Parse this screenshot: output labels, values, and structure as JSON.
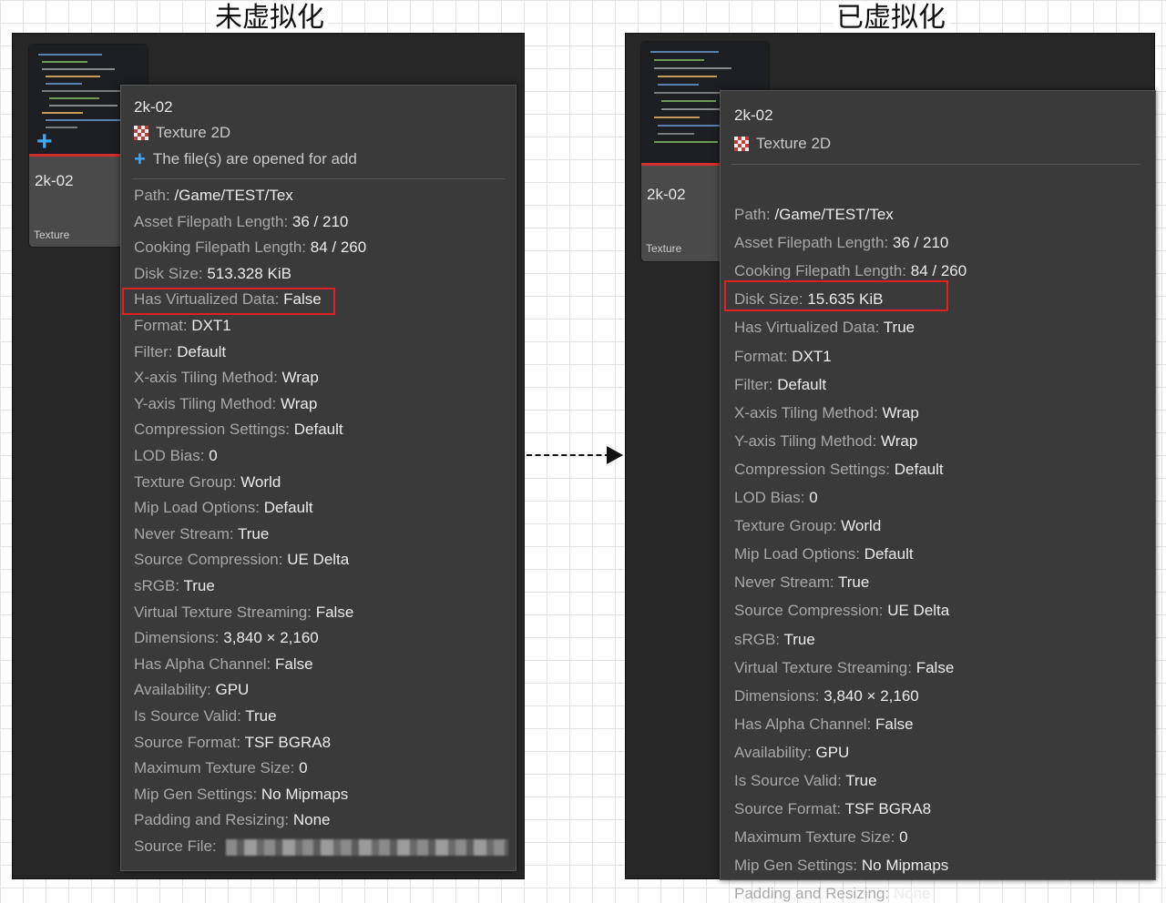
{
  "left": {
    "heading": "未虚拟化",
    "asset_name": "2k-02",
    "asset_type_label": "Texture",
    "tooltip": {
      "name": "2k-02",
      "type": "Texture 2D",
      "status": "The file(s) are opened for add",
      "rows": [
        {
          "k": "Path:",
          "v": "/Game/TEST/Tex"
        },
        {
          "k": "Asset Filepath Length:",
          "v": "36 / 210"
        },
        {
          "k": "Cooking Filepath Length:",
          "v": "84 / 260"
        },
        {
          "k": "Disk Size:",
          "v": "513.328 KiB"
        },
        {
          "k": "Has Virtualized Data:",
          "v": "False"
        },
        {
          "k": "Format:",
          "v": "DXT1"
        },
        {
          "k": "Filter:",
          "v": "Default"
        },
        {
          "k": "X-axis Tiling Method:",
          "v": "Wrap"
        },
        {
          "k": "Y-axis Tiling Method:",
          "v": "Wrap"
        },
        {
          "k": "Compression Settings:",
          "v": "Default"
        },
        {
          "k": "LOD Bias:",
          "v": "0"
        },
        {
          "k": "Texture Group:",
          "v": "World"
        },
        {
          "k": "Mip Load Options:",
          "v": "Default"
        },
        {
          "k": "Never Stream:",
          "v": "True"
        },
        {
          "k": "Source Compression:",
          "v": "UE Delta"
        },
        {
          "k": "sRGB:",
          "v": "True"
        },
        {
          "k": "Virtual Texture Streaming:",
          "v": "False"
        },
        {
          "k": "Dimensions:",
          "v": "3,840 × 2,160"
        },
        {
          "k": "Has Alpha Channel:",
          "v": "False"
        },
        {
          "k": "Availability:",
          "v": "GPU"
        },
        {
          "k": "Is Source Valid:",
          "v": "True"
        },
        {
          "k": "Source Format:",
          "v": "TSF BGRA8"
        },
        {
          "k": "Maximum Texture Size:",
          "v": "0"
        },
        {
          "k": "Mip Gen Settings:",
          "v": "No Mipmaps"
        },
        {
          "k": "Padding and Resizing:",
          "v": "None"
        },
        {
          "k": "Source File:",
          "v": ""
        }
      ]
    }
  },
  "right": {
    "heading": "已虚拟化",
    "asset_name": "2k-02",
    "asset_type_label": "Texture",
    "tooltip": {
      "name": "2k-02",
      "type": "Texture 2D",
      "rows": [
        {
          "k": "Path:",
          "v": "/Game/TEST/Tex"
        },
        {
          "k": "Asset Filepath Length:",
          "v": "36 / 210"
        },
        {
          "k": "Cooking Filepath Length:",
          "v": "84 / 260"
        },
        {
          "k": "Disk Size:",
          "v": "15.635 KiB"
        },
        {
          "k": "Has Virtualized Data:",
          "v": "True"
        },
        {
          "k": "Format:",
          "v": "DXT1"
        },
        {
          "k": "Filter:",
          "v": "Default"
        },
        {
          "k": "X-axis Tiling Method:",
          "v": "Wrap"
        },
        {
          "k": "Y-axis Tiling Method:",
          "v": "Wrap"
        },
        {
          "k": "Compression Settings:",
          "v": "Default"
        },
        {
          "k": "LOD Bias:",
          "v": "0"
        },
        {
          "k": "Texture Group:",
          "v": "World"
        },
        {
          "k": "Mip Load Options:",
          "v": "Default"
        },
        {
          "k": "Never Stream:",
          "v": "True"
        },
        {
          "k": "Source Compression:",
          "v": "UE Delta"
        },
        {
          "k": "sRGB:",
          "v": "True"
        },
        {
          "k": "Virtual Texture Streaming:",
          "v": "False"
        },
        {
          "k": "Dimensions:",
          "v": "3,840 × 2,160"
        },
        {
          "k": "Has Alpha Channel:",
          "v": "False"
        },
        {
          "k": "Availability:",
          "v": "GPU"
        },
        {
          "k": "Is Source Valid:",
          "v": "True"
        },
        {
          "k": "Source Format:",
          "v": "TSF BGRA8"
        },
        {
          "k": "Maximum Texture Size:",
          "v": "0"
        },
        {
          "k": "Mip Gen Settings:",
          "v": "No Mipmaps"
        },
        {
          "k": "Padding and Resizing:",
          "v": "None"
        }
      ]
    }
  },
  "icons": {
    "texture_icon": "checkerboard-texture-icon",
    "add_icon": "plus-icon",
    "arrow": "dashed-arrow-right"
  },
  "colors": {
    "highlight": "#e02020",
    "accent_blue": "#3fa9f5",
    "selection_red": "#d32f2f"
  }
}
